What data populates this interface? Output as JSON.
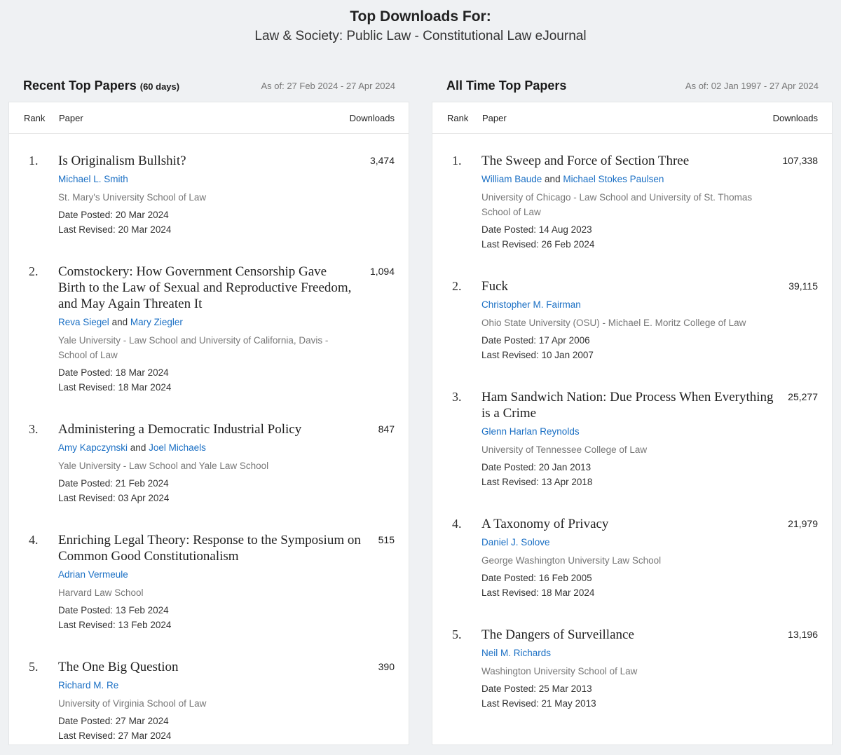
{
  "header": {
    "title": "Top Downloads For:",
    "subtitle": "Law & Society: Public Law - Constitutional Law eJournal"
  },
  "columns_labels": {
    "rank": "Rank",
    "paper": "Paper",
    "downloads": "Downloads"
  },
  "recent": {
    "title": "Recent Top Papers",
    "title_suffix": "(60 days)",
    "as_of": "As of: 27 Feb 2024 - 27 Apr 2024",
    "papers": [
      {
        "rank": "1.",
        "title": "Is Originalism Bullshit?",
        "authors": [
          "Michael L. Smith"
        ],
        "affiliation": "St. Mary's University School of Law",
        "posted": "Date Posted: 20 Mar 2024",
        "revised": "Last Revised: 20 Mar 2024",
        "downloads": "3,474"
      },
      {
        "rank": "2.",
        "title": "Comstockery: How Government Censorship Gave Birth to the Law of Sexual and Reproductive Freedom, and May Again Threaten It",
        "authors": [
          "Reva Siegel",
          "Mary Ziegler"
        ],
        "affiliation": "Yale University - Law School and University of California, Davis - School of Law",
        "posted": "Date Posted: 18 Mar 2024",
        "revised": "Last Revised: 18 Mar 2024",
        "downloads": "1,094"
      },
      {
        "rank": "3.",
        "title": "Administering a Democratic Industrial Policy",
        "authors": [
          "Amy Kapczynski",
          "Joel Michaels"
        ],
        "affiliation": "Yale University - Law School and Yale Law School",
        "posted": "Date Posted: 21 Feb 2024",
        "revised": "Last Revised: 03 Apr 2024",
        "downloads": "847"
      },
      {
        "rank": "4.",
        "title": "Enriching Legal Theory: Response to the Symposium on Common Good Constitutionalism",
        "authors": [
          "Adrian Vermeule"
        ],
        "affiliation": "Harvard Law School",
        "posted": "Date Posted: 13 Feb 2024",
        "revised": "Last Revised: 13 Feb 2024",
        "downloads": "515"
      },
      {
        "rank": "5.",
        "title": "The One Big Question",
        "authors": [
          "Richard M. Re"
        ],
        "affiliation": "University of Virginia School of Law",
        "posted": "Date Posted: 27 Mar 2024",
        "revised": "Last Revised: 27 Mar 2024",
        "downloads": "390"
      }
    ]
  },
  "alltime": {
    "title": "All Time Top Papers",
    "title_suffix": "",
    "as_of": "As of: 02 Jan 1997 - 27 Apr 2024",
    "papers": [
      {
        "rank": "1.",
        "title": "The Sweep and Force of Section Three",
        "authors": [
          "William Baude",
          "Michael Stokes Paulsen"
        ],
        "affiliation": "University of Chicago - Law School and University of St. Thomas School of Law",
        "posted": "Date Posted: 14 Aug 2023",
        "revised": "Last Revised: 26 Feb 2024",
        "downloads": "107,338"
      },
      {
        "rank": "2.",
        "title": "Fuck",
        "authors": [
          "Christopher M. Fairman"
        ],
        "affiliation": "Ohio State University (OSU) - Michael E. Moritz College of Law",
        "posted": "Date Posted: 17 Apr 2006",
        "revised": "Last Revised: 10 Jan 2007",
        "downloads": "39,115"
      },
      {
        "rank": "3.",
        "title": "Ham Sandwich Nation: Due Process When Everything is a Crime",
        "authors": [
          "Glenn Harlan Reynolds"
        ],
        "affiliation": "University of Tennessee College of Law",
        "posted": "Date Posted: 20 Jan 2013",
        "revised": "Last Revised: 13 Apr 2018",
        "downloads": "25,277"
      },
      {
        "rank": "4.",
        "title": "A Taxonomy of Privacy",
        "authors": [
          "Daniel J. Solove"
        ],
        "affiliation": "George Washington University Law School",
        "posted": "Date Posted: 16 Feb 2005",
        "revised": "Last Revised: 18 Mar 2024",
        "downloads": "21,979"
      },
      {
        "rank": "5.",
        "title": "The Dangers of Surveillance",
        "authors": [
          "Neil M. Richards"
        ],
        "affiliation": "Washington University School of Law",
        "posted": "Date Posted: 25 Mar 2013",
        "revised": "Last Revised: 21 May 2013",
        "downloads": "13,196"
      }
    ]
  },
  "author_joiner": "and",
  "colors": {
    "link": "#1a6fc4",
    "background": "#eff1f3",
    "muted": "#777777"
  }
}
